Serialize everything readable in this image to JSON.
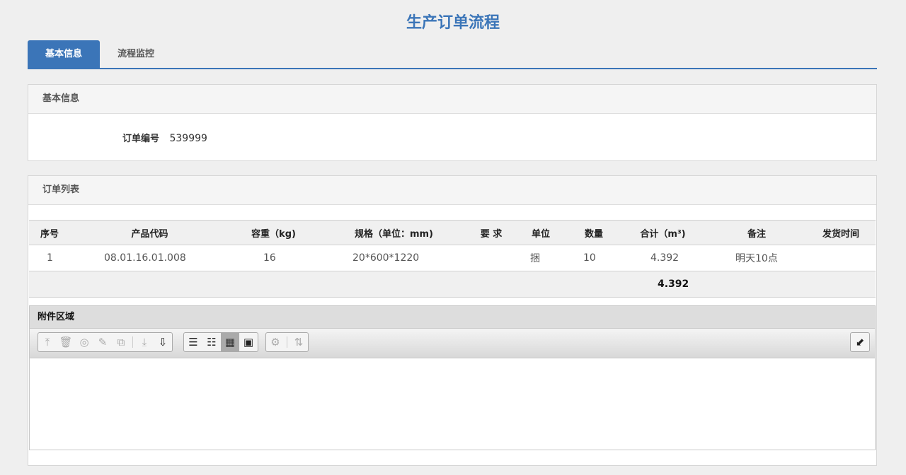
{
  "title": "生产订单流程",
  "tabs": [
    "基本信息",
    "流程监控"
  ],
  "basic": {
    "header": "基本信息",
    "order_label": "订单编号",
    "order_value": "539999"
  },
  "orders": {
    "header": "订单列表",
    "columns": [
      "序号",
      "产品代码",
      "容重（kg)",
      "规格（单位：mm)",
      "要 求",
      "单位",
      "数量",
      "合计（m³)",
      "备注",
      "发货时间"
    ],
    "rows": [
      [
        "1",
        "08.01.16.01.008",
        "16",
        "20*600*1220",
        "",
        "捆",
        "10",
        "4.392",
        "明天10点",
        ""
      ]
    ],
    "total": "4.392"
  },
  "attachments": {
    "header": "附件区域"
  }
}
